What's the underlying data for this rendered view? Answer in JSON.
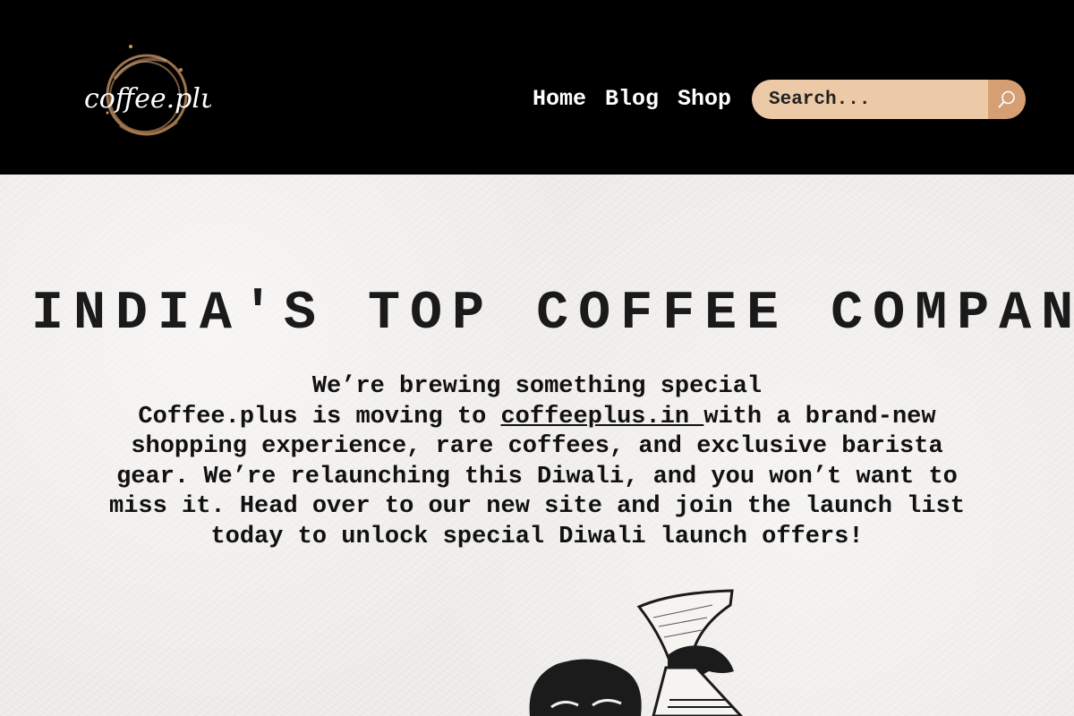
{
  "brand": {
    "logo_text": "coffee.plus"
  },
  "nav": {
    "items": [
      {
        "label": "Home"
      },
      {
        "label": "Blog"
      },
      {
        "label": "Shop"
      }
    ]
  },
  "search": {
    "placeholder": "Search...",
    "icon": "search-icon"
  },
  "hero": {
    "headline": "INDIA'S TOP COFFEE COMPANY",
    "subheading": "We’re brewing something special",
    "body_before_link": "Coffee.plus is moving to ",
    "link_text": "coffeeplus.in ",
    "body_after_link": "with a brand-new shopping experience, rare coffees, and exclusive barista gear. We’re relaunching this Diwali, and you won’t want to miss it. Head over to our new site and join the launch list today to unlock special Diwali launch offers!"
  },
  "colors": {
    "header_bg": "#000000",
    "search_bg": "#eccaa8",
    "search_button": "#d59f73",
    "paper_bg": "#f0eeeb"
  }
}
